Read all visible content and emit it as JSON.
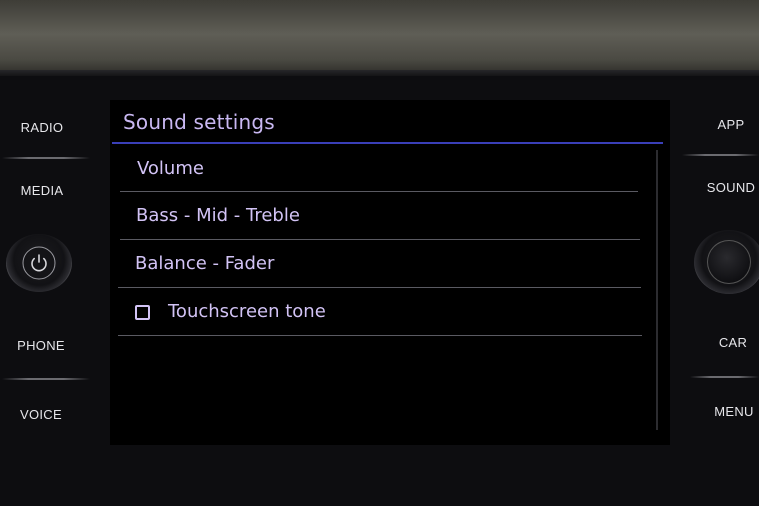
{
  "screen": {
    "title": "Sound settings",
    "menu_items": [
      {
        "label": "Volume"
      },
      {
        "label": "Bass - Mid - Treble"
      },
      {
        "label": "Balance - Fader"
      },
      {
        "label": "Touchscreen tone",
        "checkbox": true,
        "checked": false
      }
    ]
  },
  "left_buttons": {
    "radio": "RADIO",
    "media": "MEDIA",
    "phone": "PHONE",
    "voice": "VOICE"
  },
  "right_buttons": {
    "app": "APP",
    "sound": "SOUND",
    "car": "CAR",
    "menu": "MENU"
  },
  "colors": {
    "text": "#d2c3f5",
    "title": "#c9b8f2",
    "accent_rule": "#3a3fb8",
    "screen_bg": "#000000"
  },
  "icons": {
    "left_knob": "power-icon",
    "right_knob": "volume-knob"
  }
}
